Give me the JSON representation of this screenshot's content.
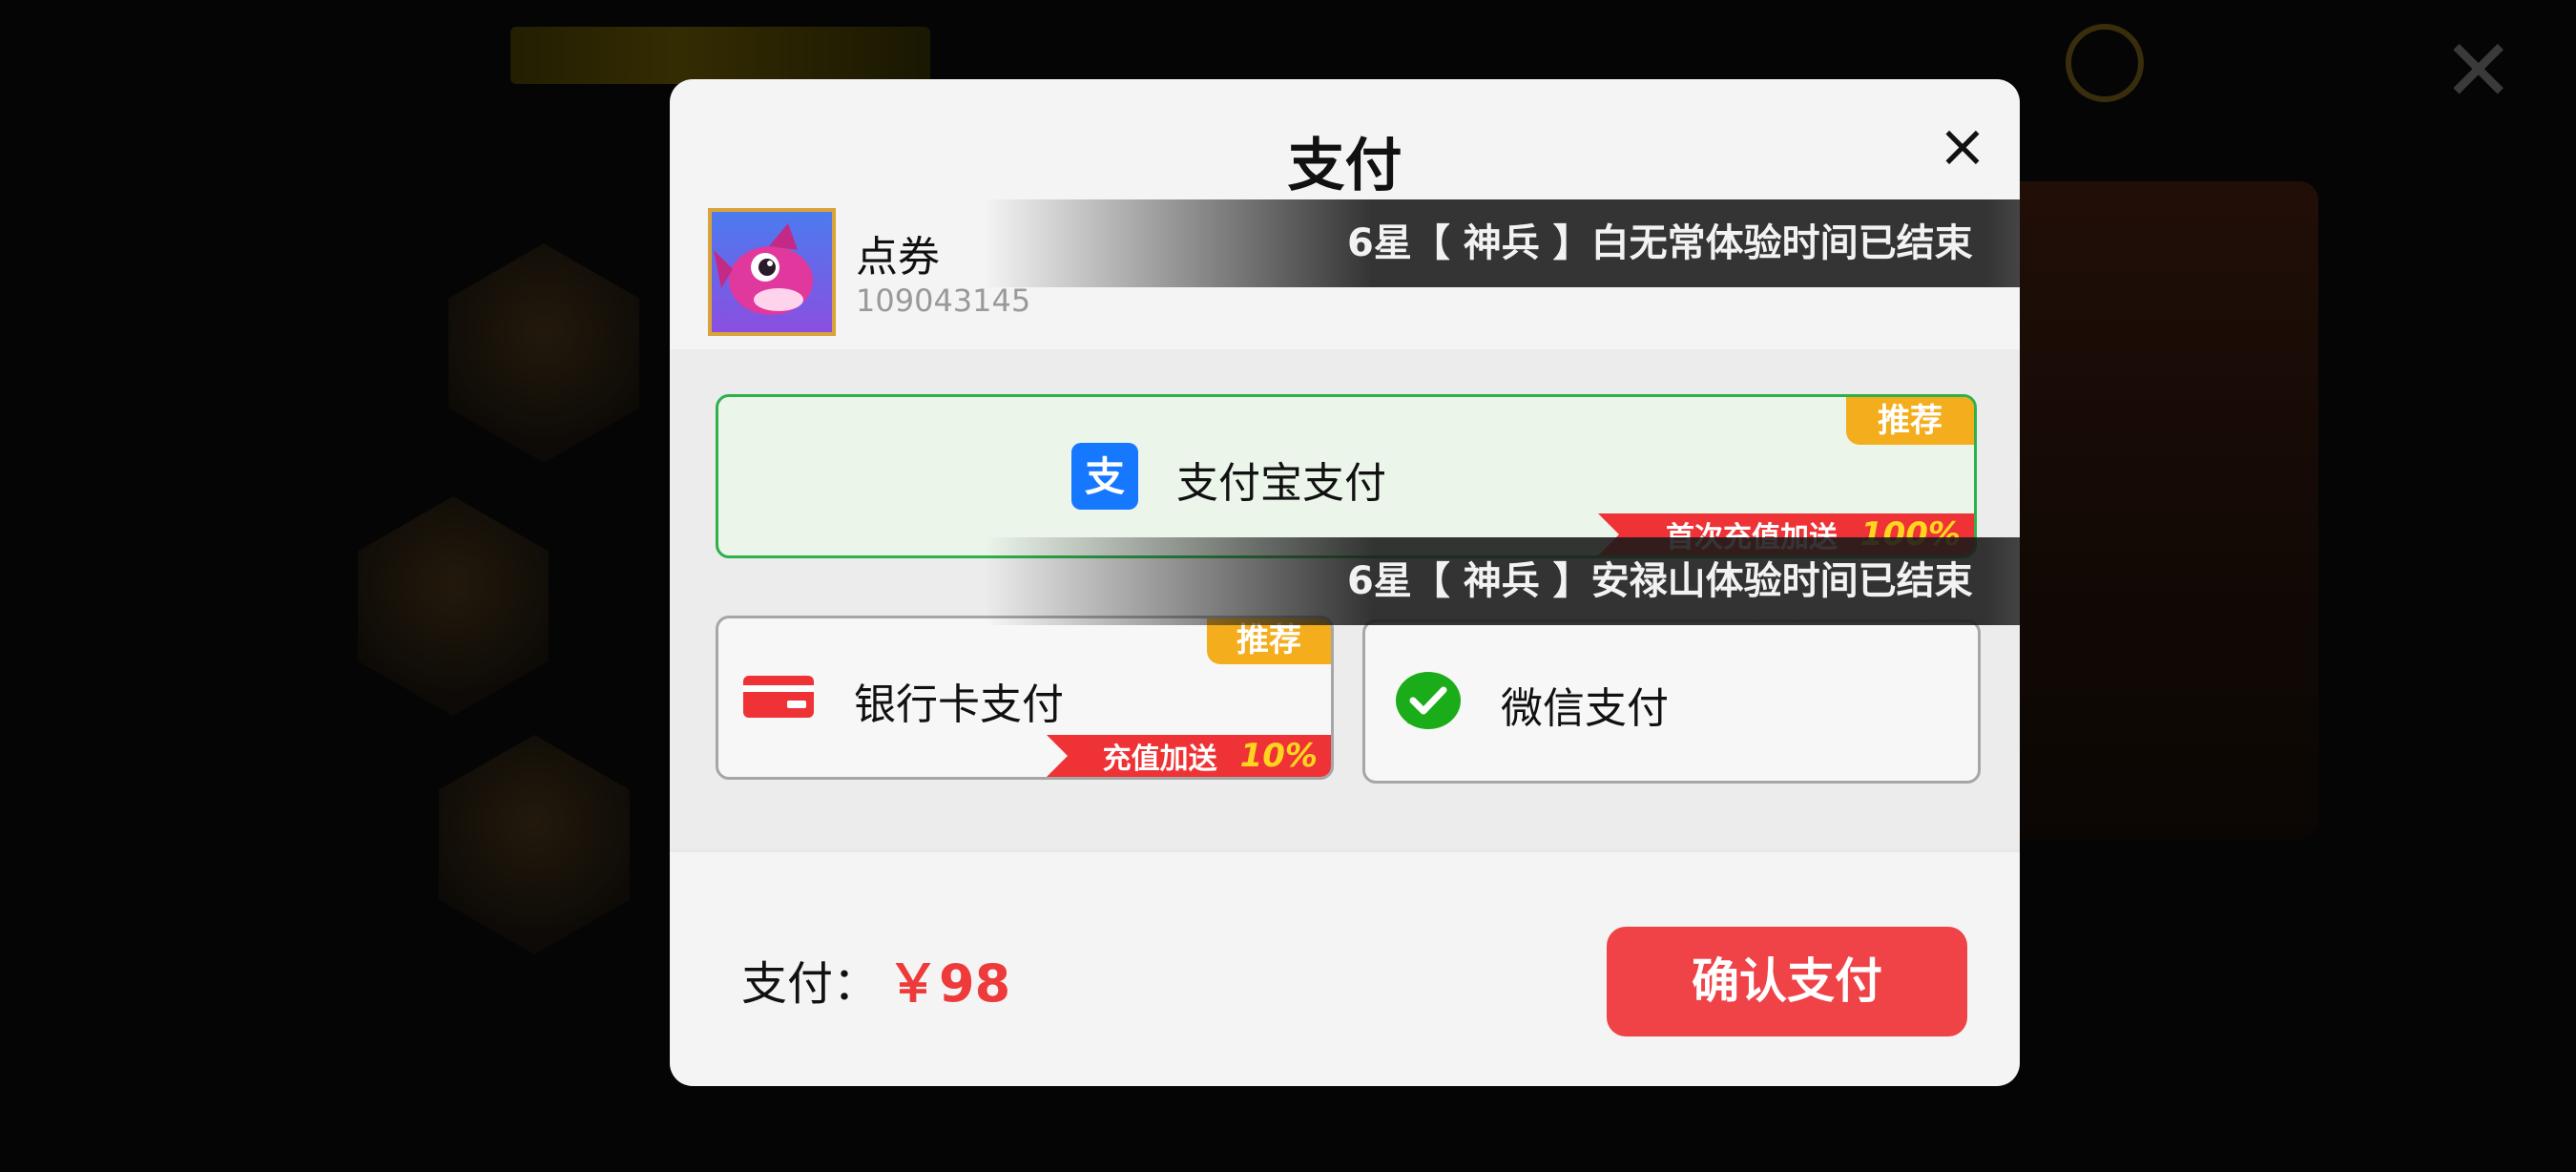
{
  "modal": {
    "title": "支付",
    "close_icon": "close-icon",
    "product": {
      "name": "点券",
      "id": "109043145"
    },
    "notices": [
      "6星【 神兵 】白无常体验时间已结束",
      "6星【 神兵 】安禄山体验时间已结束"
    ],
    "methods": {
      "alipay": {
        "label": "支付宝支付",
        "tag": "推荐",
        "bonus_text": "首次充值加送",
        "bonus_pct": "100%",
        "icon": "alipay-icon"
      },
      "bank": {
        "label": "银行卡支付",
        "tag": "推荐",
        "bonus_text": "充值加送",
        "bonus_pct": "10%",
        "icon": "bank-card-icon"
      },
      "wechat": {
        "label": "微信支付",
        "icon": "wechat-pay-icon"
      }
    },
    "footer": {
      "pay_label": "支付：",
      "amount": "￥98",
      "confirm_label": "确认支付"
    }
  },
  "colors": {
    "accent_red": "#ef4348",
    "alipay_blue": "#1677ff",
    "wechat_green": "#1aad19",
    "selected_border": "#2db14a",
    "tag_orange": "#f4ad1c"
  }
}
